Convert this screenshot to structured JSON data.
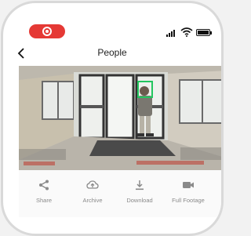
{
  "header": {
    "title": "People"
  },
  "icons": {
    "recording": "record-icon",
    "back": "back-chevron-icon",
    "signal": "cellular-signal-icon",
    "wifi": "wifi-icon",
    "battery": "battery-icon"
  },
  "toolbar": {
    "items": [
      {
        "label": "Share",
        "icon": "share-icon"
      },
      {
        "label": "Archive",
        "icon": "cloud-upload-icon"
      },
      {
        "label": "Download",
        "icon": "download-icon"
      },
      {
        "label": "Full Footage",
        "icon": "video-camera-icon"
      }
    ]
  },
  "colors": {
    "record_pill": "#e53935",
    "detection_box": "#22c55e",
    "icon_gray": "#8a8a8a"
  }
}
